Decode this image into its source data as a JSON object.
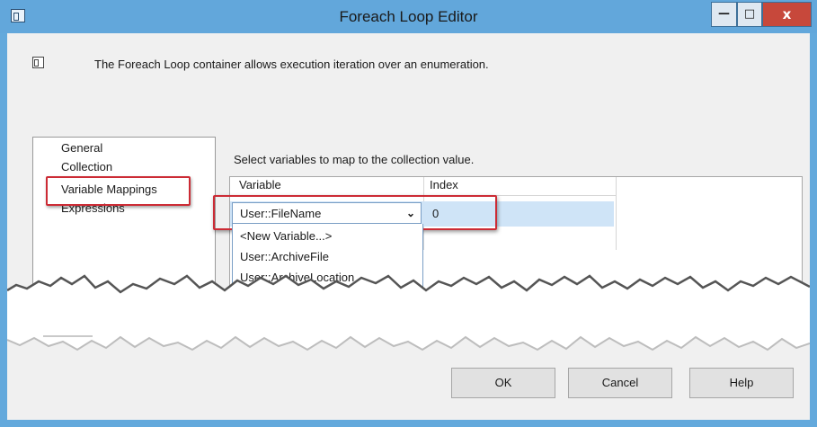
{
  "window": {
    "title": "Foreach Loop Editor",
    "minimize_glyph": "—",
    "maximize_glyph": "□",
    "close_glyph": "x"
  },
  "header": {
    "description": "The Foreach Loop container allows execution iteration over an enumeration."
  },
  "sidebar": {
    "items": [
      {
        "label": "General"
      },
      {
        "label": "Collection"
      },
      {
        "label": "Variable Mappings",
        "selected": true
      },
      {
        "label": "Expressions"
      }
    ]
  },
  "main": {
    "instruction": "Select variables to map to the collection value.",
    "columns": [
      "Variable",
      "Index"
    ],
    "row": {
      "variable": "User::FileName",
      "index": "0"
    },
    "dropdown_options": [
      "<New Variable...>",
      "User::ArchiveFile",
      "User::ArchiveLocation"
    ]
  },
  "buttons": {
    "ok": "OK",
    "cancel": "Cancel",
    "help": "Help"
  },
  "colors": {
    "title_bar": "#62a7db",
    "highlight_box": "#cc2b35",
    "selected_row": "#cfe4f7",
    "close_button": "#c7483b"
  },
  "icons": [
    "dialog-icon",
    "description-icon",
    "dropdown-arrow-icon"
  ]
}
